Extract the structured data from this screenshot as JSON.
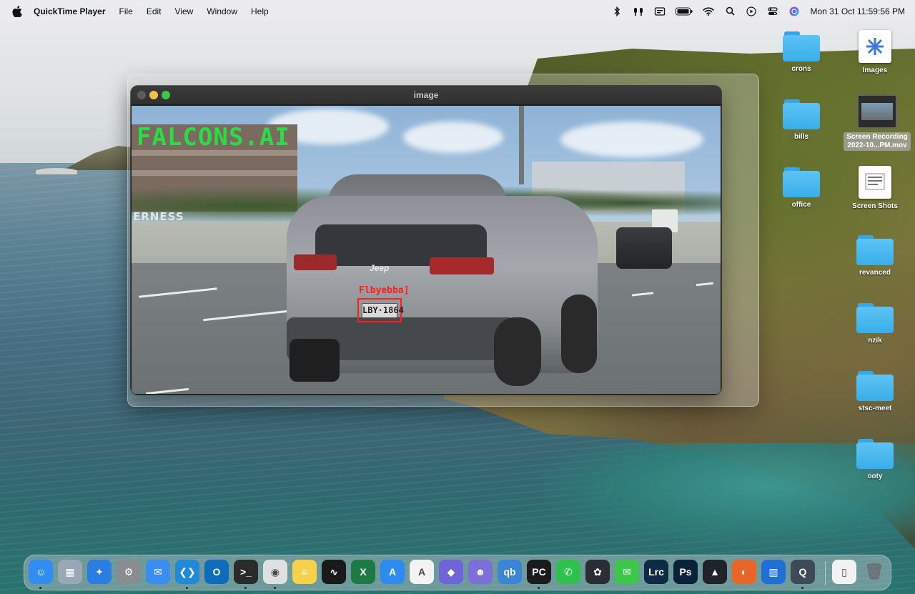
{
  "menubar": {
    "app_name": "QuickTime Player",
    "menus": [
      "File",
      "Edit",
      "View",
      "Window",
      "Help"
    ],
    "datetime": "Mon 31 Oct  11:59:56 PM",
    "status_icons": [
      "bluetooth-icon",
      "airpods-icon",
      "display-icon",
      "battery-icon",
      "wifi-icon",
      "spotlight-icon",
      "play-icon",
      "control-center-icon",
      "siri-icon"
    ]
  },
  "window": {
    "title": "image",
    "video": {
      "brand_text": "FALCONS.AI",
      "sign_text": "ERNESS",
      "detection_label": "Flbyebba]",
      "plate_text": "LBY·1864",
      "car_logo": "Jeep"
    }
  },
  "desktop": {
    "icons": [
      {
        "label": "crons",
        "type": "folder"
      },
      {
        "label": "Images",
        "type": "document"
      },
      {
        "label": "bills",
        "type": "folder"
      },
      {
        "label": "Screen Recording\n2022-10...PM.mov",
        "type": "video",
        "selected": true
      },
      {
        "label": "office",
        "type": "folder"
      },
      {
        "label": "Screen Shots",
        "type": "document"
      },
      {
        "label": "revanced",
        "type": "folder"
      },
      {
        "label": "nzik",
        "type": "folder"
      },
      {
        "label": "stsc-meet",
        "type": "folder"
      },
      {
        "label": "ooty",
        "type": "folder"
      }
    ]
  },
  "dock": {
    "apps": [
      {
        "name": "finder-icon",
        "glyph": "☺",
        "color": "#2f8ef0",
        "running": true
      },
      {
        "name": "launchpad-icon",
        "glyph": "▦",
        "color": "#9aa7b7",
        "running": false
      },
      {
        "name": "safari-icon",
        "glyph": "✦",
        "color": "#2a7de1",
        "running": false
      },
      {
        "name": "system-preferences-icon",
        "glyph": "⚙",
        "color": "#8a8d90",
        "running": false
      },
      {
        "name": "mail-icon",
        "glyph": "✉",
        "color": "#3a8ef0",
        "running": false
      },
      {
        "name": "vscode-icon",
        "glyph": "❮❯",
        "color": "#1f8ad8",
        "running": true
      },
      {
        "name": "outlook-icon",
        "glyph": "O",
        "color": "#0f6cbd",
        "running": false
      },
      {
        "name": "terminal-icon",
        "glyph": ">_",
        "color": "#2b2b2b",
        "running": true
      },
      {
        "name": "chrome-icon",
        "glyph": "◉",
        "color": "#e0e0e0",
        "running": true
      },
      {
        "name": "notes-icon",
        "glyph": "≡",
        "color": "#f7d14a",
        "running": false
      },
      {
        "name": "activity-monitor-icon",
        "glyph": "∿",
        "color": "#1a1a1a",
        "running": false
      },
      {
        "name": "excel-icon",
        "glyph": "X",
        "color": "#1d7a45",
        "running": false
      },
      {
        "name": "app-store-icon",
        "glyph": "A",
        "color": "#2d8af0",
        "running": false
      },
      {
        "name": "affinity-icon",
        "glyph": "A",
        "color": "#f3f3f3",
        "running": false
      },
      {
        "name": "cube-icon",
        "glyph": "◆",
        "color": "#6f64d8",
        "running": false
      },
      {
        "name": "robot-icon",
        "glyph": "☻",
        "color": "#7c6fd8",
        "running": false
      },
      {
        "name": "qbittorrent-icon",
        "glyph": "qb",
        "color": "#3a86d6",
        "running": false
      },
      {
        "name": "pycharm-icon",
        "glyph": "PC",
        "color": "#1b1b1b",
        "running": true
      },
      {
        "name": "whatsapp-icon",
        "glyph": "✆",
        "color": "#2ec24c",
        "running": false
      },
      {
        "name": "davinci-icon",
        "glyph": "✿",
        "color": "#2a2d33",
        "running": false
      },
      {
        "name": "messages-icon",
        "glyph": "✉",
        "color": "#3bc84a",
        "running": false
      },
      {
        "name": "lightroom-icon",
        "glyph": "Lrc",
        "color": "#0e2a44",
        "running": false
      },
      {
        "name": "photoshop-icon",
        "glyph": "Ps",
        "color": "#0b2238",
        "running": false
      },
      {
        "name": "prism-icon",
        "glyph": "▲",
        "color": "#20242a",
        "running": false
      },
      {
        "name": "firefox-icon",
        "glyph": "◐",
        "color": "#e8652a",
        "running": false
      },
      {
        "name": "trello-icon",
        "glyph": "▥",
        "color": "#1f6fd6",
        "running": false
      },
      {
        "name": "quicktime-icon",
        "glyph": "Q",
        "color": "#3e4a55",
        "running": true
      },
      {
        "name": "document-icon",
        "glyph": "▯",
        "color": "#f2f2f2",
        "running": false
      },
      {
        "name": "trash-icon",
        "glyph": "🗑",
        "color": "transparent",
        "running": false
      }
    ]
  }
}
